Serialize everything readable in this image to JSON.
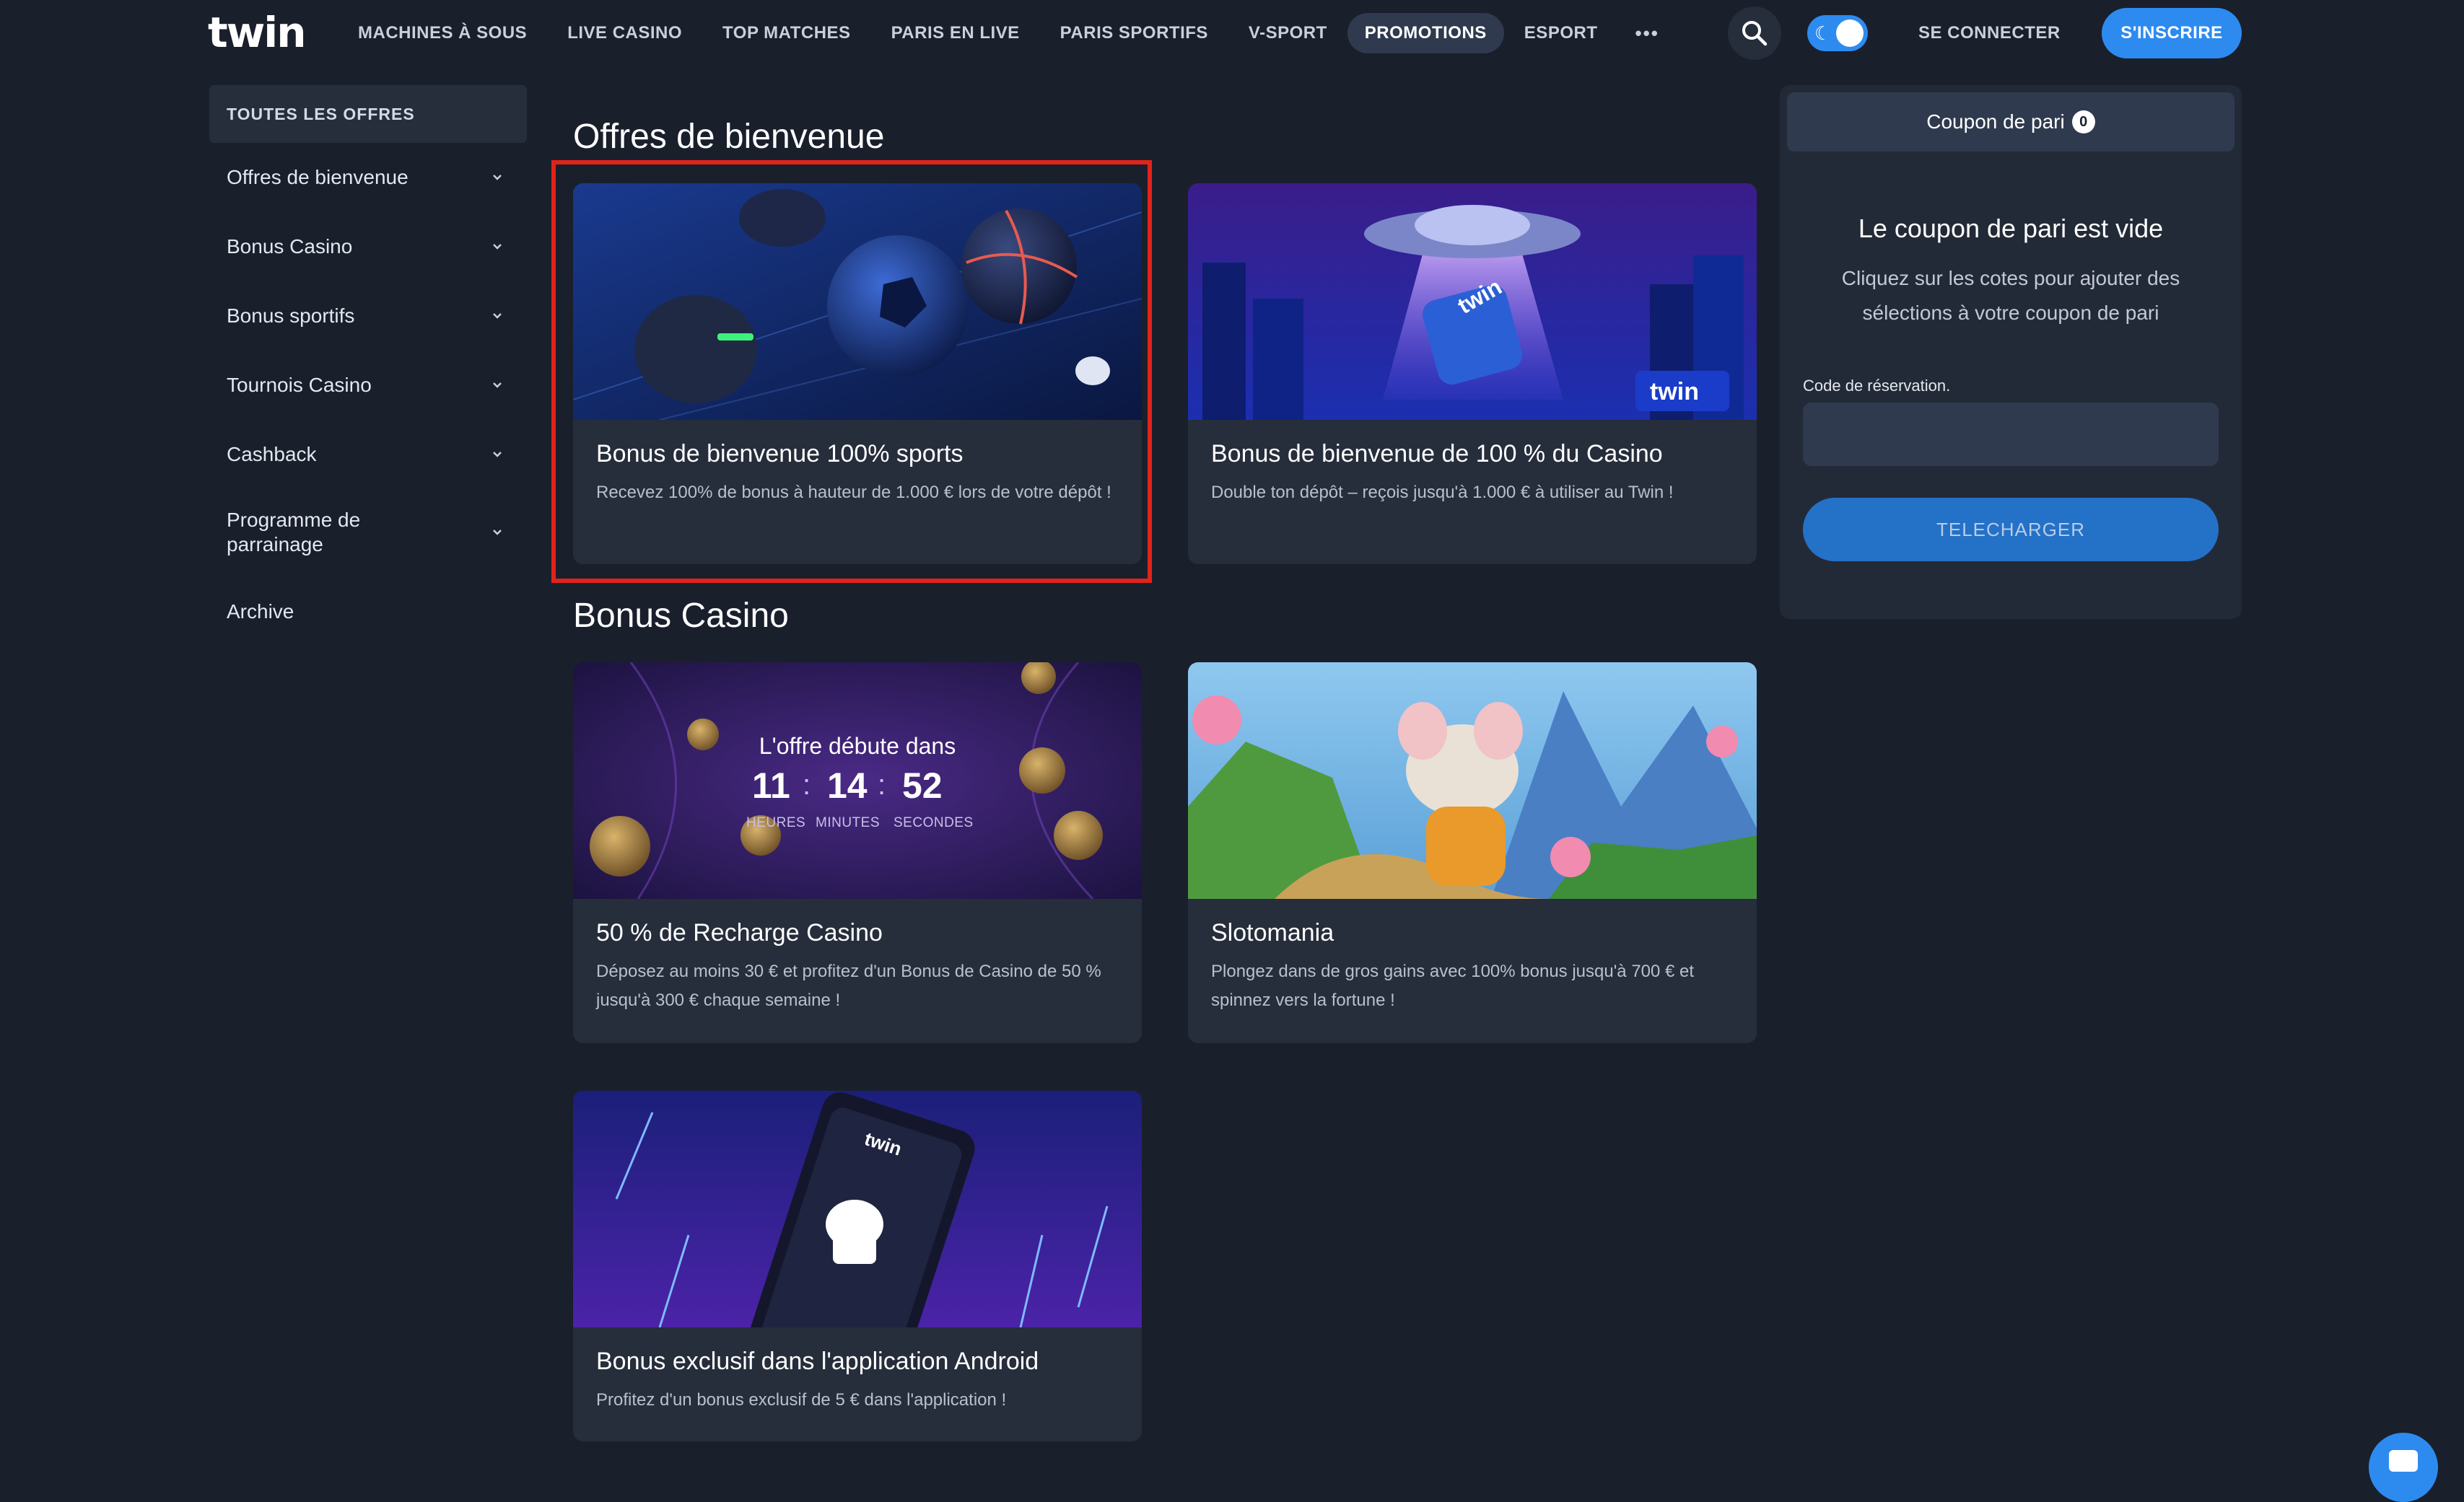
{
  "header": {
    "logo": "twin",
    "nav": [
      "MACHINES À SOUS",
      "LIVE CASINO",
      "TOP MATCHES",
      "PARIS EN LIVE",
      "PARIS SPORTIFS",
      "V-SPORT",
      "PROMOTIONS",
      "ESPORT"
    ],
    "active_nav": "PROMOTIONS",
    "more_label": "•••",
    "login": "SE CONNECTER",
    "register": "S'INSCRIRE",
    "theme_toggle_on": true
  },
  "sidebar": {
    "all_offers": "TOUTES LES OFFRES",
    "items": [
      "Offres de bienvenue",
      "Bonus Casino",
      "Bonus sportifs",
      "Tournois Casino",
      "Cashback",
      "Programme de parrainage",
      "Archive"
    ]
  },
  "sections": [
    {
      "title": "Offres de bienvenue",
      "cards": [
        {
          "title": "Bonus de bienvenue 100% sports",
          "desc": "Recevez 100% de bonus à hauteur de 1.000 € lors de votre dépôt !",
          "image": "sports-balls-icon"
        },
        {
          "title": "Bonus de bienvenue de 100 % du Casino",
          "desc": "Double ton dépôt – reçois jusqu'à 1.000 € à utiliser au Twin !",
          "image": "ufo-cube-icon",
          "image_label": "twin"
        }
      ]
    },
    {
      "title": "Bonus Casino",
      "cards": [
        {
          "title": "50 % de Recharge Casino",
          "desc": "Déposez au moins 30 € et profitez d'un Bonus de Casino de 50 % jusqu'à 300 € chaque semaine !",
          "image": "countdown-coins-icon"
        },
        {
          "title": "Slotomania",
          "desc": "Plongez dans de gros gains avec 100% bonus jusqu'à 700 € et spinnez vers la fortune !",
          "image": "mouse-character-icon"
        },
        {
          "title": "Bonus exclusif dans l'application Android",
          "desc": "Profitez d'un bonus exclusif de 5 € dans l'application !",
          "image": "android-phone-icon",
          "image_label": "twin"
        }
      ]
    }
  ],
  "countdown": {
    "title": "L'offre débute dans",
    "hours": "11",
    "minutes": "14",
    "seconds": "52",
    "hours_label": "HEURES",
    "minutes_label": "MINUTES",
    "seconds_label": "SECONDES"
  },
  "coupon": {
    "tab": "Coupon de pari",
    "count": "0",
    "empty_title": "Le coupon de pari est vide",
    "hint": "Cliquez sur les cotes pour ajouter des sélections à votre coupon de pari",
    "code_label": "Code de réservation.",
    "code_value": "",
    "download": "TELECHARGER"
  },
  "colors": {
    "background": "#1a1f2c",
    "card": "#262d3b",
    "accent": "#2d8bf0",
    "highlight": "#e2231a"
  }
}
